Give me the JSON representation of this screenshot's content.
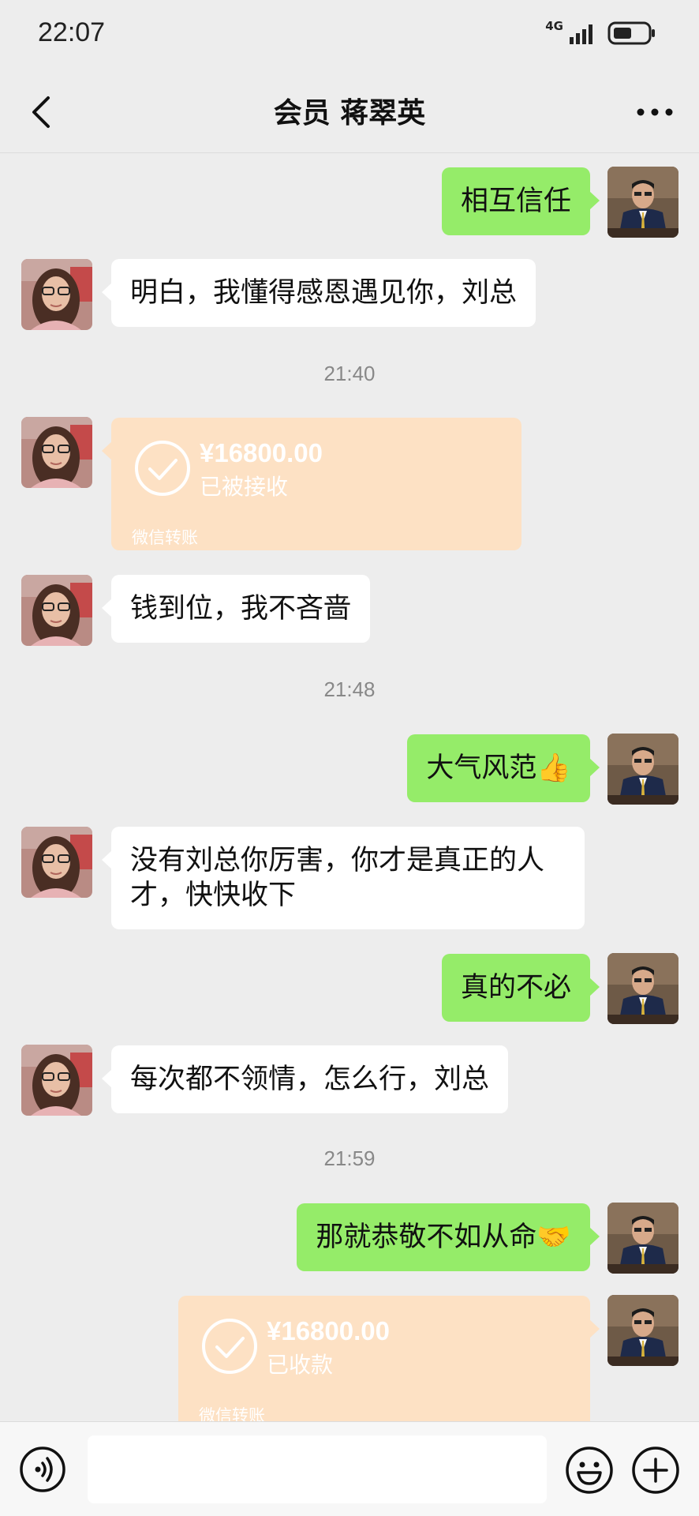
{
  "status_bar": {
    "time": "22:07",
    "network": "4G"
  },
  "header": {
    "title": "会员 蒋翠英",
    "back_icon": "chevron-left-icon",
    "more_icon": "more-horizontal-icon"
  },
  "messages": [
    {
      "type": "text",
      "side": "out",
      "text": "相互信任"
    },
    {
      "type": "text",
      "side": "in",
      "text": "明白，我懂得感恩遇见你，刘总"
    },
    {
      "type": "time",
      "text": "21:40"
    },
    {
      "type": "transfer",
      "side": "in",
      "amount": "¥16800.00",
      "status": "已被接收",
      "label": "微信转账"
    },
    {
      "type": "text",
      "side": "in",
      "text": "钱到位，我不吝啬"
    },
    {
      "type": "time",
      "text": "21:48"
    },
    {
      "type": "text",
      "side": "out",
      "text": "大气风范👍"
    },
    {
      "type": "text",
      "side": "in",
      "text": "没有刘总你厉害，你才是真正的人才，快快收下"
    },
    {
      "type": "text",
      "side": "out",
      "text": "真的不必"
    },
    {
      "type": "text",
      "side": "in",
      "text": "每次都不领情，怎么行，刘总"
    },
    {
      "type": "time",
      "text": "21:59"
    },
    {
      "type": "text",
      "side": "out",
      "text": "那就恭敬不如从命🤝"
    },
    {
      "type": "transfer",
      "side": "out",
      "amount": "¥16800.00",
      "status": "已收款",
      "label": "微信转账"
    }
  ],
  "input_bar": {
    "placeholder": "",
    "voice_icon": "voice-icon",
    "emoji_icon": "emoji-icon",
    "plus_icon": "plus-icon"
  },
  "colors": {
    "background": "#ededed",
    "outgoing_bubble": "#95ec69",
    "incoming_bubble": "#ffffff",
    "transfer_card": "#fde1c4"
  }
}
